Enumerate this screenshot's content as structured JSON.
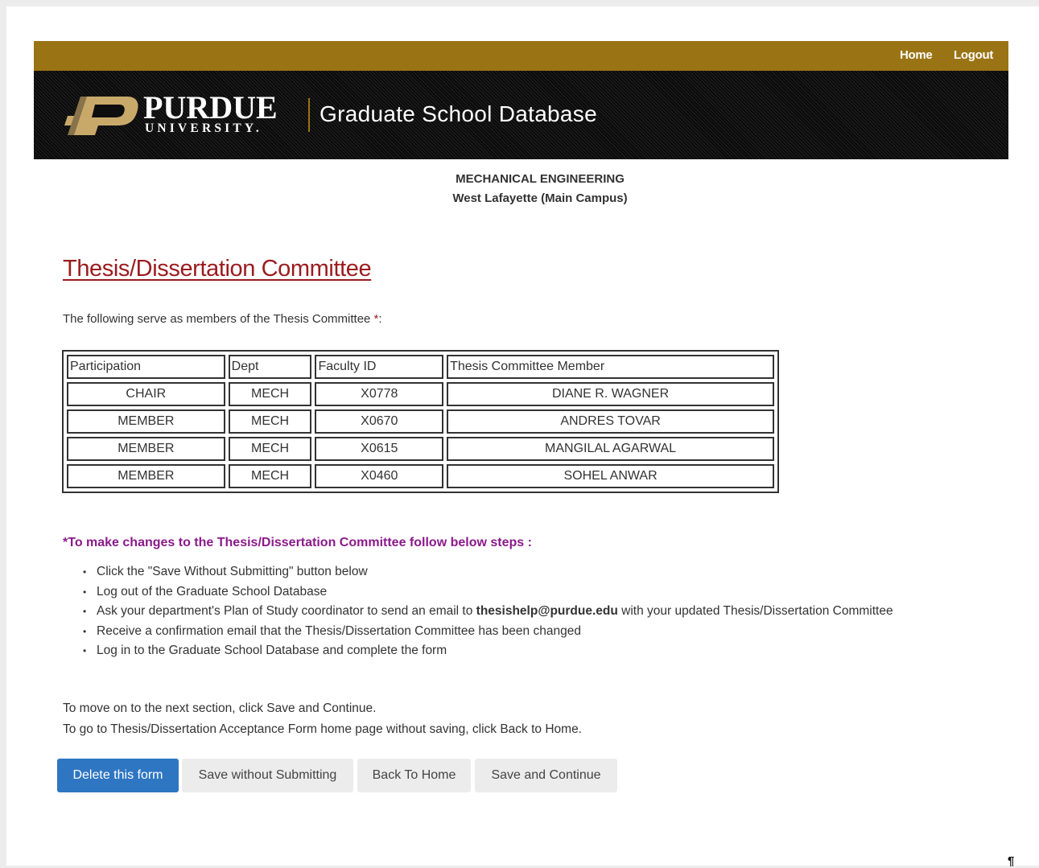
{
  "topbar": {
    "home_label": "Home",
    "logout_label": "Logout"
  },
  "banner": {
    "logo_word": "PURDUE",
    "logo_sub": "UNIVERSITY.",
    "title": "Graduate School Database"
  },
  "department": {
    "name": "MECHANICAL ENGINEERING",
    "campus": "West Lafayette (Main Campus)"
  },
  "page": {
    "heading": "Thesis/Dissertation Committee",
    "intro": "The following serve as members of the Thesis Committee ",
    "intro_required_mark": "*",
    "intro_end": ":"
  },
  "committee_table": {
    "headers": [
      "Participation",
      "Dept",
      "Faculty ID",
      "Thesis Committee Member"
    ],
    "rows": [
      [
        "CHAIR",
        "MECH",
        "X0778",
        "DIANE R. WAGNER"
      ],
      [
        "MEMBER",
        "MECH",
        "X0670",
        "ANDRES TOVAR"
      ],
      [
        "MEMBER",
        "MECH",
        "X0615",
        "MANGILAL AGARWAL"
      ],
      [
        "MEMBER",
        "MECH",
        "X0460",
        "SOHEL ANWAR"
      ]
    ]
  },
  "change_steps": {
    "heading": "*To make changes to the Thesis/Dissertation Committee follow below steps :",
    "items": [
      "Click the \"Save Without Submitting\" button below",
      "Log out of the Graduate School Database",
      "Ask your department's Plan of Study coordinator to send an email to ",
      "Receive a confirmation email that the Thesis/Dissertation Committee has been changed",
      "Log in to the Graduate School Database and complete the form"
    ],
    "email": "thesishelp@purdue.edu",
    "email_suffix": " with your updated Thesis/Dissertation Committee"
  },
  "navigation_help": {
    "line1": "To move on to the next section, click Save and Continue.",
    "line2": "To go to Thesis/Dissertation Acceptance Form home page without saving, click Back to Home."
  },
  "buttons": {
    "delete": "Delete this form",
    "save_without_submitting": "Save without Submitting",
    "back_to_home": "Back To Home",
    "save_and_continue": "Save and Continue"
  },
  "colors": {
    "gold": "#9a7414",
    "heading_red": "#9b1b1e",
    "steps_purple": "#8b1a8b",
    "primary_blue": "#2e76c2"
  },
  "misc": {
    "pilcrow": "¶"
  }
}
